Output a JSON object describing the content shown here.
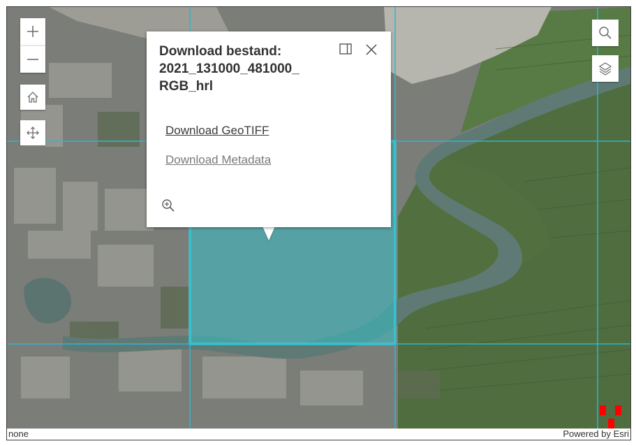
{
  "popup": {
    "title_line1": "Download bestand:",
    "title_line2": "2021_131000_481000_",
    "title_line3": "RGB_hrl",
    "link_geotiff": "Download GeoTIFF",
    "link_metadata": "Download Metadata"
  },
  "controls": {
    "zoom_in": "+",
    "zoom_out": "−"
  },
  "icons": {
    "home": "home-icon",
    "navigate": "pan-arrows-icon",
    "search": "search-icon",
    "layers": "layers-icon",
    "dock": "dock-icon",
    "close": "close-icon",
    "zoom_to": "zoom-to-icon",
    "marker": "red-block-marker-icon"
  },
  "attribution": {
    "left": "none",
    "right": "Powered by Esri"
  },
  "colors": {
    "tile_grid": "#27b8d6",
    "highlight_fill": "#36bfc6",
    "highlight_border": "#38e0e8",
    "marker": "#ff0000"
  }
}
